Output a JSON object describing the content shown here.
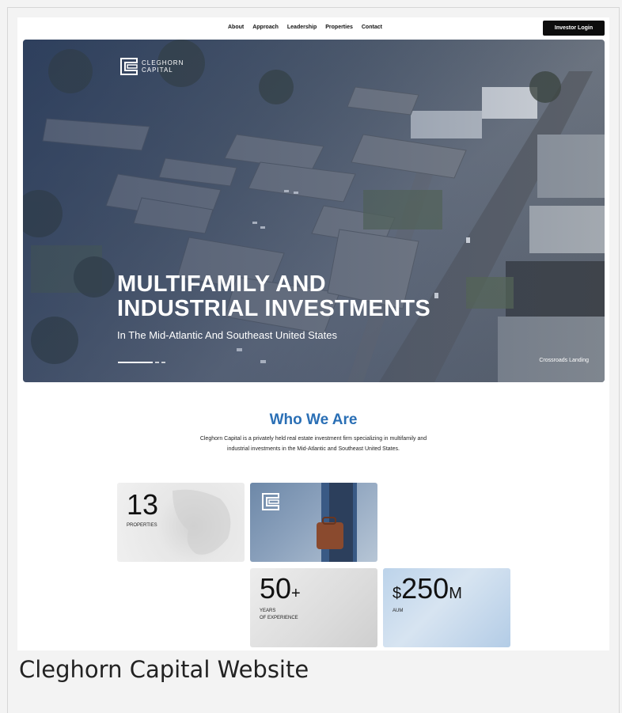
{
  "nav": {
    "links": [
      "About",
      "Approach",
      "Leadership",
      "Properties",
      "Contact"
    ],
    "login_label": "Investor Login"
  },
  "hero": {
    "logo_line1": "CLEGHORN",
    "logo_line2": "CAPITAL",
    "title_line1": "MULTIFAMILY AND",
    "title_line2": "INDUSTRIAL INVESTMENTS",
    "subtitle": "In The Mid-Atlantic And Southeast United States",
    "image_caption": "Crossroads Landing"
  },
  "who": {
    "title": "Who We Are",
    "text": "Cleghorn Capital is a privately held real estate investment firm specializing in multifamily and industrial investments in the Mid-Atlantic and Southeast United States."
  },
  "stats": {
    "properties": {
      "value": "13",
      "label": "PROPERTIES"
    },
    "years": {
      "value": "50",
      "suffix": "+",
      "label": "YEARS\nOF EXPERIENCE"
    },
    "aum": {
      "prefix": "$",
      "value": "250",
      "suffix": "M",
      "label": "AUM"
    }
  },
  "page_caption": "Cleghorn Capital Website",
  "colors": {
    "accent": "#2a6fb5",
    "login_bg": "#0d0d0d"
  }
}
